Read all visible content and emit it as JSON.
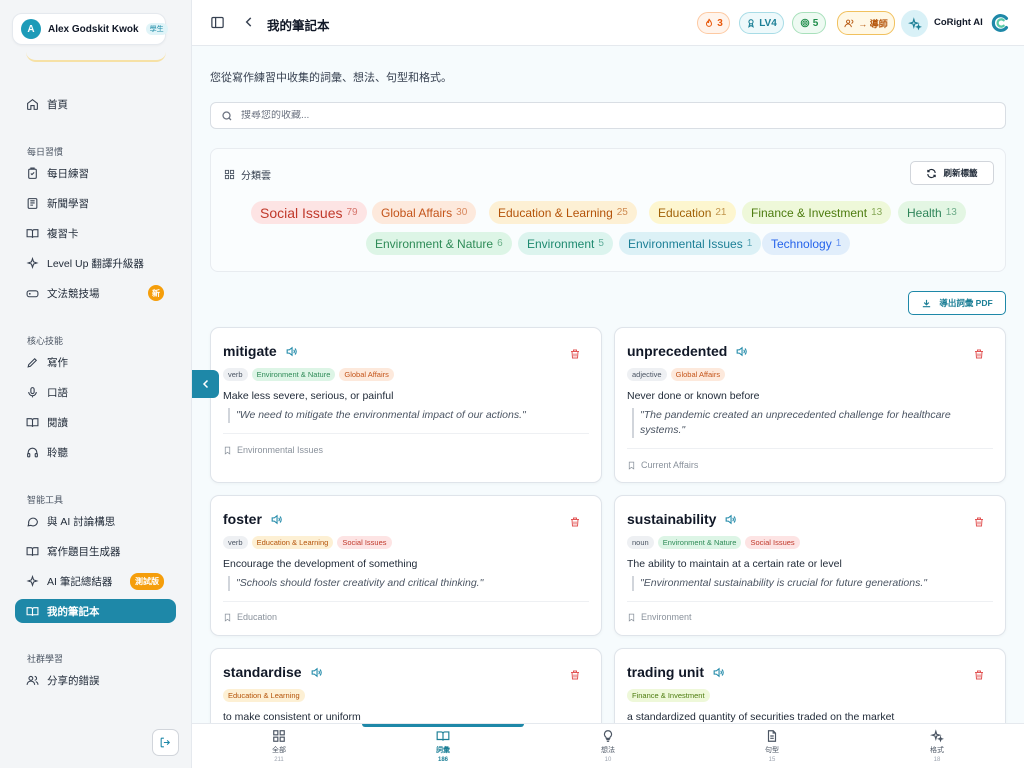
{
  "user": {
    "initial": "A",
    "name": "Alex Godskit Kwok",
    "role_badge": "學生"
  },
  "sidebar": {
    "home": "首頁",
    "groups": {
      "daily": "每日習慣",
      "core": "核心技能",
      "tools": "智能工具",
      "community": "社群學習"
    },
    "items": {
      "daily_practice": "每日練習",
      "news": "新聞學習",
      "review_cards": "複習卡",
      "level_up": "Level Up 翻譯升級器",
      "grammar": "文法競技場",
      "grammar_badge": "新",
      "writing": "寫作",
      "speaking": "口語",
      "reading": "閱讀",
      "listening": "聆聽",
      "ai_discuss": "與 AI 討論構思",
      "topic_gen": "寫作題目生成器",
      "notes_summary": "AI 筆記總結器",
      "notes_summary_badge": "測試版",
      "notebook": "我的筆記本",
      "shared_mistakes": "分享的錯誤"
    }
  },
  "header": {
    "title": "我的筆記本",
    "streak": "3",
    "level": "LV4",
    "points": "5",
    "tutor": "→ 導師",
    "ai_name": "CoRight AI"
  },
  "page": {
    "subtitle": "您從寫作練習中收集的詞彙、想法、句型和格式。",
    "search_placeholder": "搜尋您的收藏...",
    "cloud_title": "分類雲",
    "refresh": "刷新標籤",
    "export": "導出詞彙 PDF"
  },
  "tag_cloud": [
    {
      "name": "Social Issues",
      "count": "79"
    },
    {
      "name": "Global Affairs",
      "count": "30"
    },
    {
      "name": "Education & Learning",
      "count": "25"
    },
    {
      "name": "Education",
      "count": "21"
    },
    {
      "name": "Finance & Investment",
      "count": "13"
    },
    {
      "name": "Health",
      "count": "13"
    },
    {
      "name": "Environment & Nature",
      "count": "6"
    },
    {
      "name": "Environment",
      "count": "5"
    },
    {
      "name": "Environmental Issues",
      "count": "1"
    },
    {
      "name": "Technology",
      "count": "1"
    }
  ],
  "tag_colors": {
    "Social Issues": {
      "bg": "#fde4e4",
      "fg": "#c0392b"
    },
    "Global Affairs": {
      "bg": "#fde9dc",
      "fg": "#c4541a"
    },
    "Education & Learning": {
      "bg": "#fdf0d4",
      "fg": "#b45309"
    },
    "Education": {
      "bg": "#fdf6cf",
      "fg": "#a16207"
    },
    "Finance & Investment": {
      "bg": "#eef8d9",
      "fg": "#4d7c0f"
    },
    "Health": {
      "bg": "#e3f6e3",
      "fg": "#2f855a"
    },
    "Environment & Nature": {
      "bg": "#ddf5e6",
      "fg": "#2e8b57"
    },
    "Environment": {
      "bg": "#dcf4ee",
      "fg": "#1f8a70"
    },
    "Environmental Issues": {
      "bg": "#dcf1f6",
      "fg": "#1c7f96"
    },
    "Technology": {
      "bg": "#e1eefb",
      "fg": "#2563eb"
    }
  },
  "cards": [
    {
      "word": "mitigate",
      "pos": "verb",
      "tags": [
        "Environment & Nature",
        "Global Affairs"
      ],
      "definition": "Make less severe, serious, or painful",
      "example": "\"We need to mitigate the environmental impact of our actions.\"",
      "source": "Environmental Issues"
    },
    {
      "word": "unprecedented",
      "pos": "adjective",
      "tags": [
        "Global Affairs"
      ],
      "definition": "Never done or known before",
      "example": "\"The pandemic created an unprecedented challenge for healthcare systems.\"",
      "source": "Current Affairs"
    },
    {
      "word": "foster",
      "pos": "verb",
      "tags": [
        "Education & Learning",
        "Social Issues"
      ],
      "definition": "Encourage the development of something",
      "example": "\"Schools should foster creativity and critical thinking.\"",
      "source": "Education"
    },
    {
      "word": "sustainability",
      "pos": "noun",
      "tags": [
        "Environment & Nature",
        "Social Issues"
      ],
      "definition": "The ability to maintain at a certain rate or level",
      "example": "\"Environmental sustainability is crucial for future generations.\"",
      "source": "Environment"
    },
    {
      "word": "standardise",
      "pos": "",
      "tags": [
        "Education & Learning"
      ],
      "definition": "to make consistent or uniform",
      "example": "",
      "source": ""
    },
    {
      "word": "trading unit",
      "pos": "",
      "tags": [
        "Finance & Investment"
      ],
      "definition": "a standardized quantity of securities traded on the market",
      "example": "",
      "source": ""
    }
  ],
  "bottom_nav": [
    {
      "label": "全部",
      "count": "211",
      "icon": "grid-icon"
    },
    {
      "label": "詞彙",
      "count": "186",
      "icon": "book-icon"
    },
    {
      "label": "想法",
      "count": "10",
      "icon": "bulb-icon"
    },
    {
      "label": "句型",
      "count": "15",
      "icon": "document-icon"
    },
    {
      "label": "格式",
      "count": "18",
      "icon": "sparkle-icon"
    }
  ],
  "colors": {
    "accent": "#1e88a8",
    "delete": "#e25555"
  }
}
